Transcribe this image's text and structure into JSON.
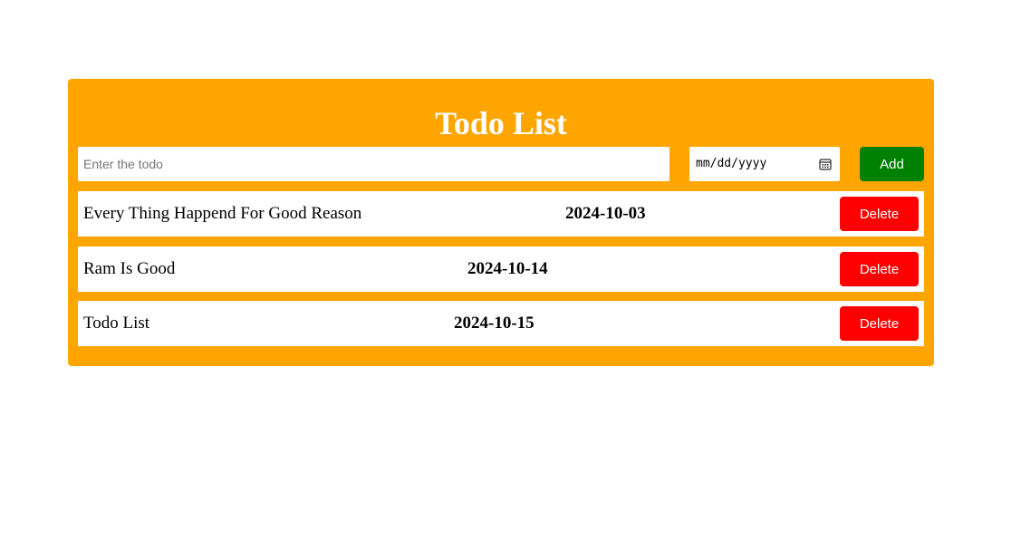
{
  "app": {
    "title": "Todo List"
  },
  "form": {
    "todo_placeholder": "Enter the todo",
    "todo_value": "",
    "date_placeholder": "mm/dd/yyyy",
    "add_label": "Add"
  },
  "todos": [
    {
      "text": "Every Thing Happend For Good Reason",
      "date": "2024-10-03",
      "delete_label": "Delete"
    },
    {
      "text": "Ram Is Good",
      "date": "2024-10-14",
      "delete_label": "Delete"
    },
    {
      "text": "Todo List",
      "date": "2024-10-15",
      "delete_label": "Delete"
    }
  ],
  "colors": {
    "card_background": "#FFA500",
    "add_button": "#008000",
    "delete_button": "#FF0000",
    "title_text": "#FFFFFF"
  },
  "icons": {
    "date_picker": "calendar-icon"
  }
}
